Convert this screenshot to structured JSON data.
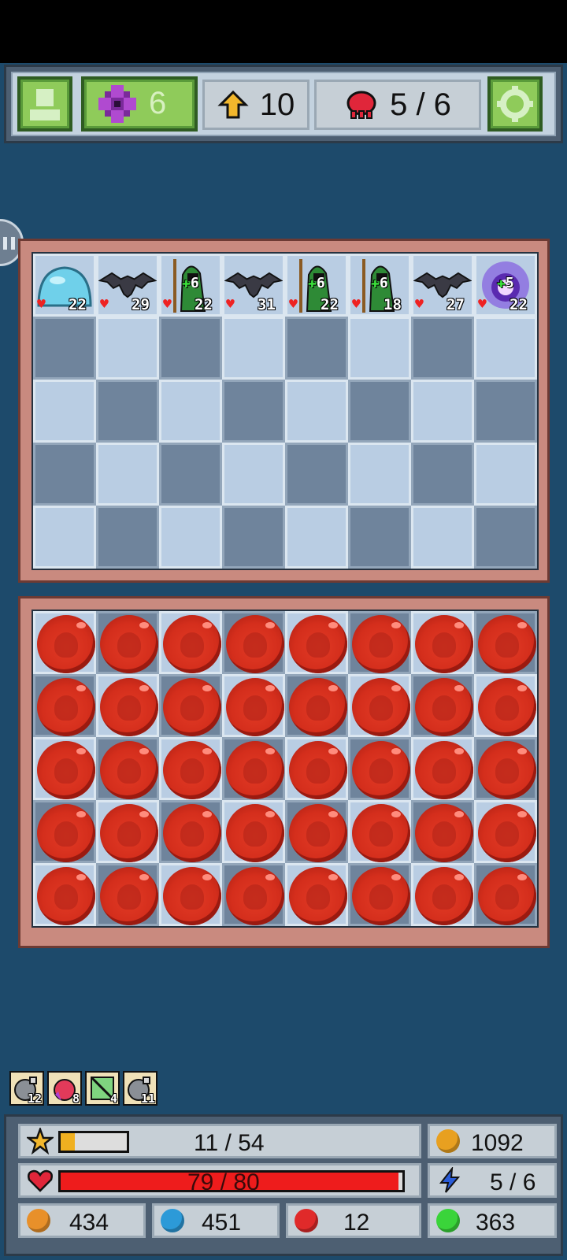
{
  "hud": {
    "gems": "6",
    "level": "10",
    "wave": "5 / 6"
  },
  "enemies": [
    {
      "name": "slime",
      "hp": "22"
    },
    {
      "name": "bat",
      "hp": "29"
    },
    {
      "name": "hooded-mage",
      "hp": "22",
      "buff": "6"
    },
    {
      "name": "bat",
      "hp": "31"
    },
    {
      "name": "hooded-mage",
      "hp": "22",
      "buff": "6"
    },
    {
      "name": "hooded-mage",
      "hp": "18",
      "buff": "6"
    },
    {
      "name": "bat",
      "hp": "27"
    },
    {
      "name": "ghost-orb",
      "hp": "22",
      "buff": "5"
    }
  ],
  "inventory": [
    {
      "icon": "bomb-icon",
      "count": "12"
    },
    {
      "icon": "potion-icon",
      "count": "8"
    },
    {
      "icon": "scroll-icon",
      "count": "4"
    },
    {
      "icon": "bomb-icon",
      "count": "11"
    }
  ],
  "stats": {
    "xp": "11 / 54",
    "xp_fill": 0.21,
    "gold": "1092",
    "hp": "79 / 80",
    "hp_fill": 0.9875,
    "mana": "5 / 6",
    "orange": "434",
    "blue": "451",
    "red": "12",
    "green": "363"
  },
  "colors": {
    "fire_orb": "#d42e1c",
    "board_frame": "#c98a7f",
    "background": "#1d4a6b"
  }
}
